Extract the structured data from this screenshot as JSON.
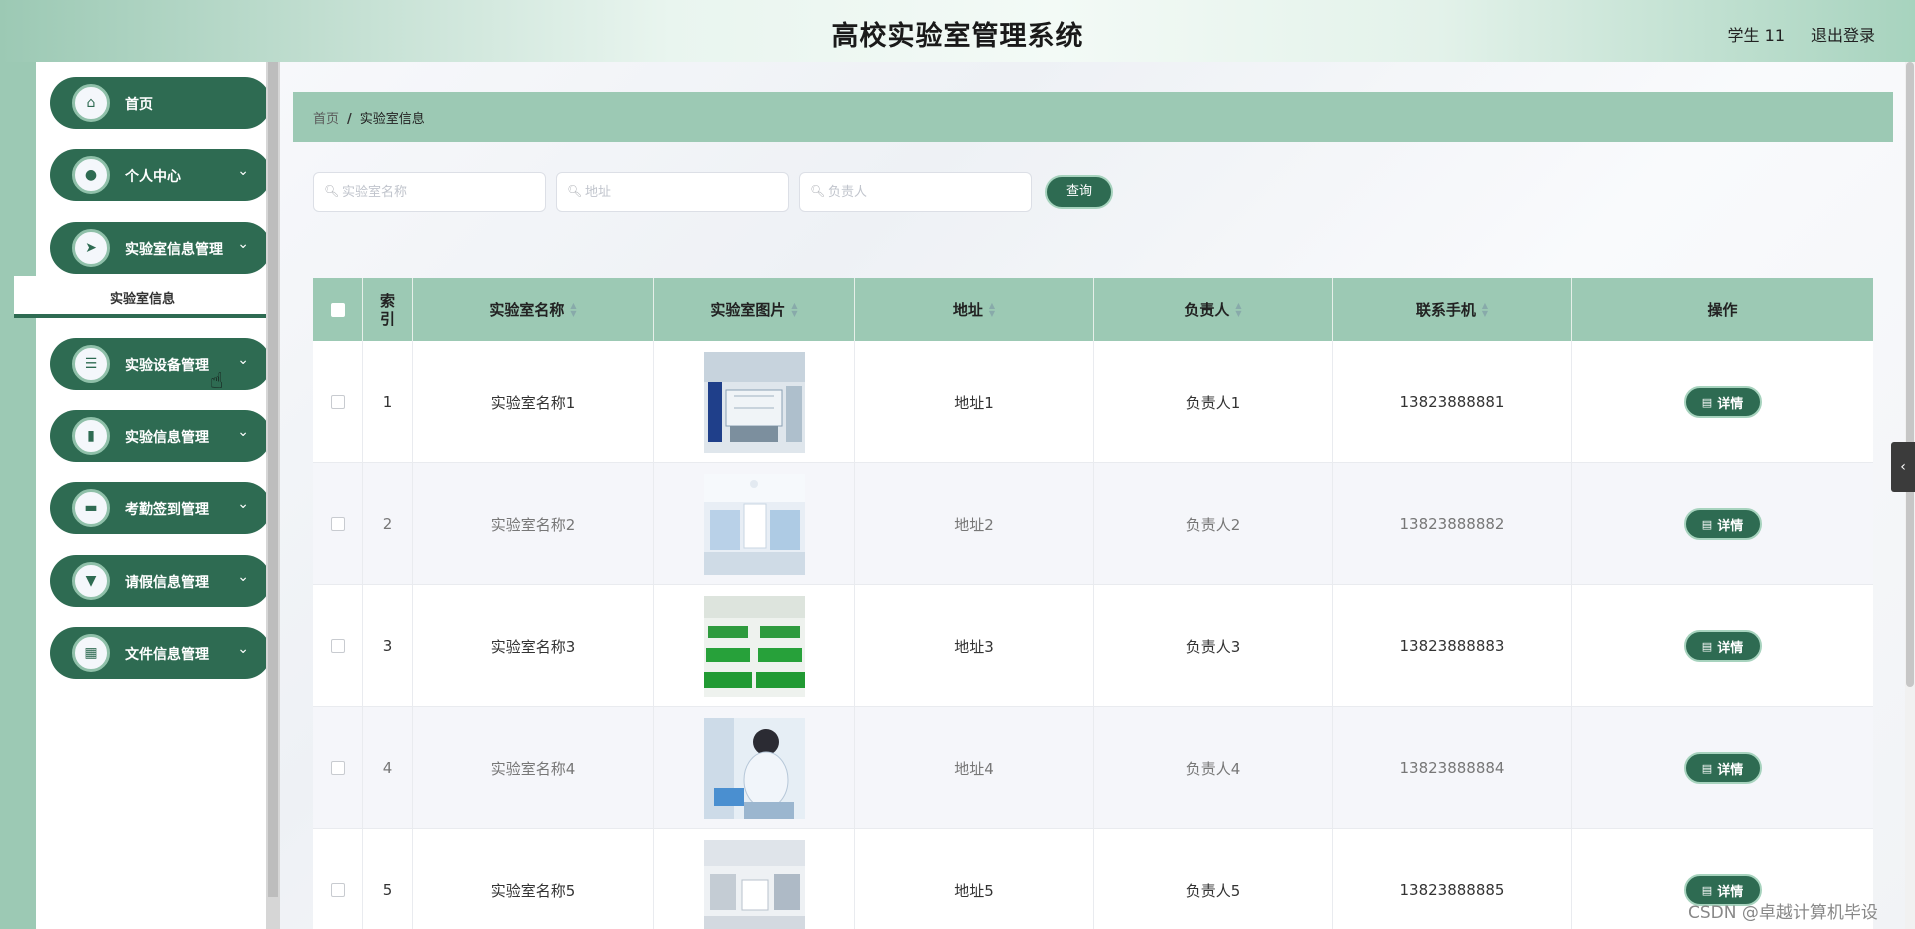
{
  "header": {
    "title": "高校实验室管理系统",
    "user": "学生 11",
    "logout": "退出登录"
  },
  "sidebar": {
    "items": [
      {
        "label": "首页",
        "icon": "home-icon",
        "icon_char": "⌂"
      },
      {
        "label": "个人中心",
        "icon": "user-icon",
        "icon_char": "●"
      },
      {
        "label": "实验室信息管理",
        "icon": "send-icon",
        "icon_char": "➤"
      },
      {
        "label": "实验设备管理",
        "icon": "list-icon",
        "icon_char": "☰"
      },
      {
        "label": "实验信息管理",
        "icon": "bar-chart-icon",
        "icon_char": "▮"
      },
      {
        "label": "考勤签到管理",
        "icon": "calendar-icon",
        "icon_char": "▬"
      },
      {
        "label": "请假信息管理",
        "icon": "card-icon",
        "icon_char": "▼"
      },
      {
        "label": "文件信息管理",
        "icon": "grid-icon",
        "icon_char": "▦"
      }
    ],
    "submenu_label": "实验室信息",
    "chevron": "⌄"
  },
  "breadcrumb": {
    "home": "首页",
    "sep": "/",
    "current": "实验室信息"
  },
  "search": {
    "name_placeholder": "实验室名称",
    "address_placeholder": "地址",
    "manager_placeholder": "负责人",
    "button": "查询"
  },
  "table": {
    "headers": {
      "index": "索\n引",
      "name": "实验室名称",
      "image": "实验室图片",
      "address": "地址",
      "manager": "负责人",
      "phone": "联系手机",
      "action": "操作"
    },
    "rows": [
      {
        "index": "1",
        "name": "实验室名称1",
        "address": "地址1",
        "manager": "负责人1",
        "phone": "13823888881",
        "action": "详情"
      },
      {
        "index": "2",
        "name": "实验室名称2",
        "address": "地址2",
        "manager": "负责人2",
        "phone": "13823888882",
        "action": "详情"
      },
      {
        "index": "3",
        "name": "实验室名称3",
        "address": "地址3",
        "manager": "负责人3",
        "phone": "13823888883",
        "action": "详情"
      },
      {
        "index": "4",
        "name": "实验室名称4",
        "address": "地址4",
        "manager": "负责人4",
        "phone": "13823888884",
        "action": "详情"
      },
      {
        "index": "5",
        "name": "实验室名称5",
        "address": "地址5",
        "manager": "负责人5",
        "phone": "13823888885",
        "action": "详情"
      }
    ]
  },
  "watermark": "CSDN @卓越计算机毕设",
  "colors": {
    "primary": "#2e6b52",
    "accent": "#9cc9b4"
  }
}
